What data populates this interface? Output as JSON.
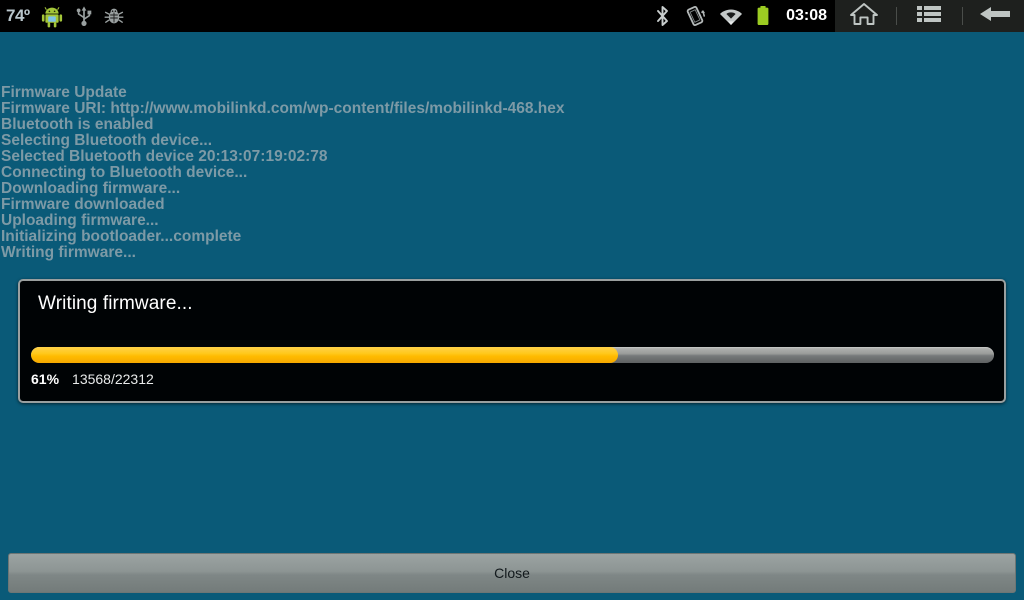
{
  "statusbar": {
    "temperature": "74º",
    "clock": "03:08",
    "left_icons": [
      {
        "name": "android-mascot-icon"
      },
      {
        "name": "usb-icon"
      },
      {
        "name": "debug-bug-icon"
      }
    ],
    "right_icons": [
      {
        "name": "bluetooth-icon"
      },
      {
        "name": "screen-rotation-icon"
      },
      {
        "name": "wifi-icon"
      },
      {
        "name": "battery-icon"
      }
    ],
    "nav": [
      {
        "name": "home-icon"
      },
      {
        "name": "menu-icon"
      },
      {
        "name": "back-icon"
      }
    ]
  },
  "log": {
    "lines": [
      "Firmware Update",
      "Firmware URI: http://www.mobilinkd.com/wp-content/files/mobilinkd-468.hex",
      "Bluetooth is enabled",
      "Selecting Bluetooth device...",
      "Selected Bluetooth device 20:13:07:19:02:78",
      "Connecting to Bluetooth device...",
      "Downloading firmware...",
      "Firmware downloaded",
      "Uploading firmware...",
      "Initializing bootloader...complete",
      "Writing firmware..."
    ]
  },
  "dialog": {
    "title": "Writing firmware...",
    "progress_percent_label": "61%",
    "progress_percent_value": 61,
    "progress_count": "13568/22312",
    "progress_current": 13568,
    "progress_total": 22312,
    "fill_color": "#ffbb00",
    "track_color": "#8a8d8c"
  },
  "footer": {
    "close_label": "Close"
  },
  "colors": {
    "background": "#0a5a78",
    "log_text": "#7d9aa6",
    "statusbar_background": "#000000",
    "navbar_background": "#1e201e",
    "dialog_background": "#000305",
    "dialog_border": "#9a9f9f",
    "accent": "#ffbb00",
    "battery": "#9ccc22"
  }
}
